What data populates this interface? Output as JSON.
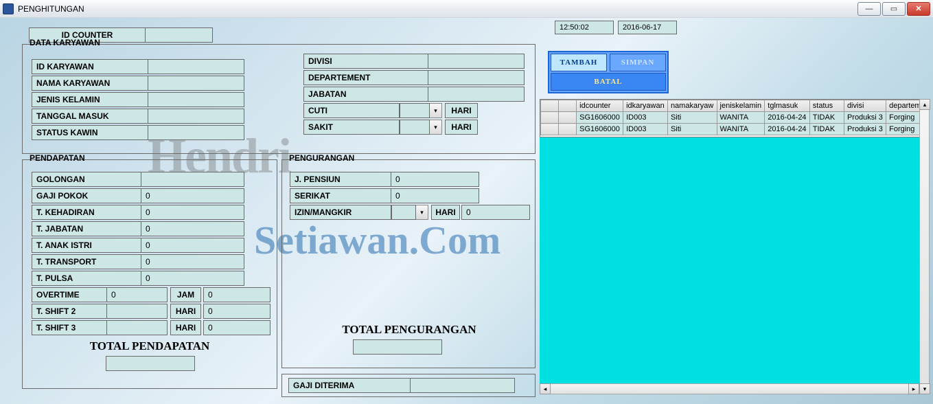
{
  "window": {
    "title": "PENGHITUNGAN"
  },
  "top": {
    "idcounter_label": "ID COUNTER",
    "idcounter_value": "",
    "time": "12:50:02",
    "date": "2016-06-17"
  },
  "karyawan": {
    "legend": "DATA KARYAWAN",
    "rows": [
      {
        "label": "ID KARYAWAN",
        "value": ""
      },
      {
        "label": "NAMA KARYAWAN",
        "value": ""
      },
      {
        "label": "JENIS KELAMIN",
        "value": ""
      },
      {
        "label": "TANGGAL MASUK",
        "value": ""
      },
      {
        "label": "STATUS KAWIN",
        "value": ""
      }
    ],
    "right": [
      {
        "label": "DIVISI",
        "value": ""
      },
      {
        "label": "DEPARTEMENT",
        "value": ""
      },
      {
        "label": "JABATAN",
        "value": ""
      }
    ],
    "cuti_label": "CUTI",
    "cuti_value": "",
    "cuti_unit": "HARI",
    "sakit_label": "SAKIT",
    "sakit_value": "",
    "sakit_unit": "HARI"
  },
  "pendapatan": {
    "legend": "PENDAPATAN",
    "rows": [
      {
        "label": "GOLONGAN",
        "value": ""
      },
      {
        "label": "GAJI POKOK",
        "value": "0"
      },
      {
        "label": "T. KEHADIRAN",
        "value": "0"
      },
      {
        "label": "T. JABATAN",
        "value": "0"
      },
      {
        "label": "T. ANAK ISTRI",
        "value": "0"
      },
      {
        "label": "T. TRANSPORT",
        "value": "0"
      },
      {
        "label": "T. PULSA",
        "value": "0"
      }
    ],
    "overtime": {
      "label": "OVERTIME",
      "value": "0",
      "unit": "JAM",
      "amount": "0"
    },
    "shift2": {
      "label": "T. SHIFT 2",
      "value": "",
      "unit": "HARI",
      "amount": "0"
    },
    "shift3": {
      "label": "T. SHIFT 3",
      "value": "",
      "unit": "HARI",
      "amount": "0"
    },
    "total_label": "TOTAL PENDAPATAN",
    "total_value": ""
  },
  "pengurangan": {
    "legend": "PENGURANGAN",
    "pensiun": {
      "label": "J. PENSIUN",
      "value": "0"
    },
    "serikat": {
      "label": "SERIKAT",
      "value": "0"
    },
    "izin": {
      "label": "IZIN/MANGKIR",
      "select": "",
      "unit": "HARI",
      "amount": "0"
    },
    "total_label": "TOTAL PENGURANGAN",
    "total_value": ""
  },
  "gaji": {
    "label": "GAJI DITERIMA",
    "value": ""
  },
  "buttons": {
    "tambah": "TAMBAH",
    "simpan": "SIMPAN",
    "batal": "BATAL"
  },
  "grid": {
    "headers": [
      "idcounter",
      "idkaryawan",
      "namakaryaw",
      "jeniskelamin",
      "tglmasuk",
      "status",
      "divisi",
      "departeme"
    ],
    "rows": [
      [
        "SG1606000",
        "ID003",
        "Siti",
        "WANITA",
        "2016-04-24",
        "TIDAK",
        "Produksi 3",
        "Forging"
      ],
      [
        "SG1606000",
        "ID003",
        "Siti",
        "WANITA",
        "2016-04-24",
        "TIDAK",
        "Produksi 3",
        "Forging"
      ]
    ]
  },
  "watermark": {
    "line1": "Hendri",
    "line2": "Setiawan.Com"
  }
}
